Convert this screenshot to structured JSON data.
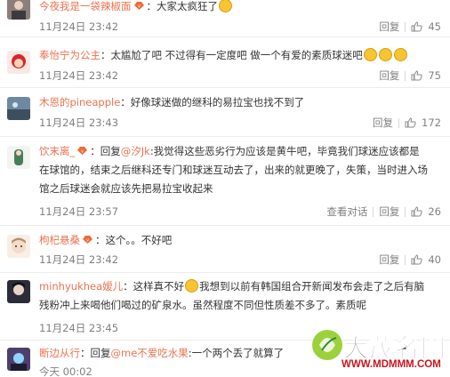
{
  "colors": {
    "username": "#eb7350",
    "meta": "#808080",
    "emoji": "#f7c531"
  },
  "actions": {
    "reply": "回复",
    "view_conversation": "查看对话"
  },
  "comments": [
    {
      "username": "今夜我是一袋辣椒面",
      "text_after_user": "：大家太疯狂了",
      "time": "11月24日 23:42",
      "likes": "45"
    },
    {
      "username": "奉怡宁为公主",
      "text_after_user": "：太尴尬了吧 不过得有一定度吧 做一个有爱的素质球迷吧",
      "time": "11月24日 23:42",
      "likes": "75"
    },
    {
      "username": "木恩的pineapple",
      "text_after_user": "：好像球迷做的继科的易拉宝也找不到了",
      "time": "11月24日 23:43",
      "likes": "172"
    },
    {
      "username": "饮末离_",
      "reply_prefix": "：回复",
      "at_user": "@汐Jk",
      "text_line1": ":我觉得这些恶劣行为应该是黄牛吧，毕竟我们球迷应该都是",
      "text_line2": "在球馆的，结束之后继科还专门和球迷互动去了，出来的就更晚了，失策，当时进入场",
      "text_line3": "馆之后球迷会就应该先把易拉宝收起来",
      "time": "11月24日 23:57",
      "likes": "26"
    },
    {
      "username": "枸杞悬桑",
      "text_after_user": "：这个。。不好吧",
      "time": "11月24日 23:42",
      "likes": "40"
    },
    {
      "username": "minhyukhea嫒儿",
      "text_line1": "：这样真不好",
      "text_line1b": "我想到以前有韩国组合开新闻发布会走了之后有脑",
      "text_line2": "残粉冲上来喝他们喝过的矿泉水。虽然程度不同但性质差不多了。素质呢",
      "time": "11月24日 23:45",
      "likes": ""
    },
    {
      "username": "断边从行",
      "reply_prefix": "：回复",
      "at_user": "@me不爱吃水果",
      "text_after_user": ":一个两个丢了就算了",
      "time": "今天 00:02",
      "likes": ""
    }
  ],
  "watermark": {
    "title": "大茂名网",
    "url": "WWW.MDMMM.COM"
  }
}
